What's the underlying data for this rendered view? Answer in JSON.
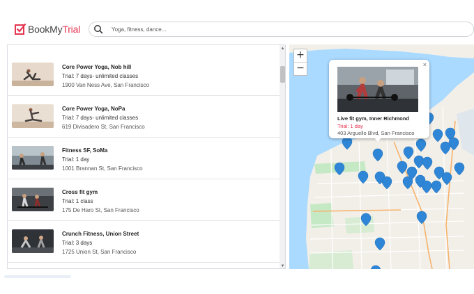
{
  "header": {
    "logo_prefix": "BookMy",
    "logo_suffix": "Trial",
    "search_placeholder": "Yoga, fitness, dance..."
  },
  "listings": [
    {
      "name": "Core Power Yoga, Nob hill",
      "trial": "Trial: 7 days- unlimited classes",
      "address": "1900 Van Ness Ave, San Francisco",
      "photo": "yoga-photo"
    },
    {
      "name": "Core Power Yoga, NoPa",
      "trial": "Trial: 7 days- unlimited classes",
      "address": "619 Divisadero St, San Francisco",
      "photo": "yoga-photo"
    },
    {
      "name": "Fitness SF, SoMa",
      "trial": "Trial: 1 day",
      "address": "1001 Brannan St, San Francisco",
      "photo": "gym-photo"
    },
    {
      "name": "Cross fit gym",
      "trial": "Trial: 1 class",
      "address": "175 De Haro St, San Francisco",
      "photo": "gym-photo"
    },
    {
      "name": "Crunch Fitness, Union Street",
      "trial": "Trial: 3 days",
      "address": "1725 Union St, San Francisco",
      "photo": "gym-photo"
    }
  ],
  "scrollbar": {
    "up_arrow": "▲",
    "down_arrow": "▼"
  },
  "map": {
    "zoom_in": "+",
    "zoom_out": "−",
    "popup": {
      "name": "Live fit gym, Inner Richmond",
      "trial": "Trial: 1 day",
      "address": "403 Arguello Blvd, San Francisco",
      "close": "×"
    }
  },
  "colors": {
    "brand": "#e5344f",
    "pin": "#2f86d6",
    "water": "#aadaff",
    "land": "#f2efe9",
    "park": "#c5e8c5"
  }
}
